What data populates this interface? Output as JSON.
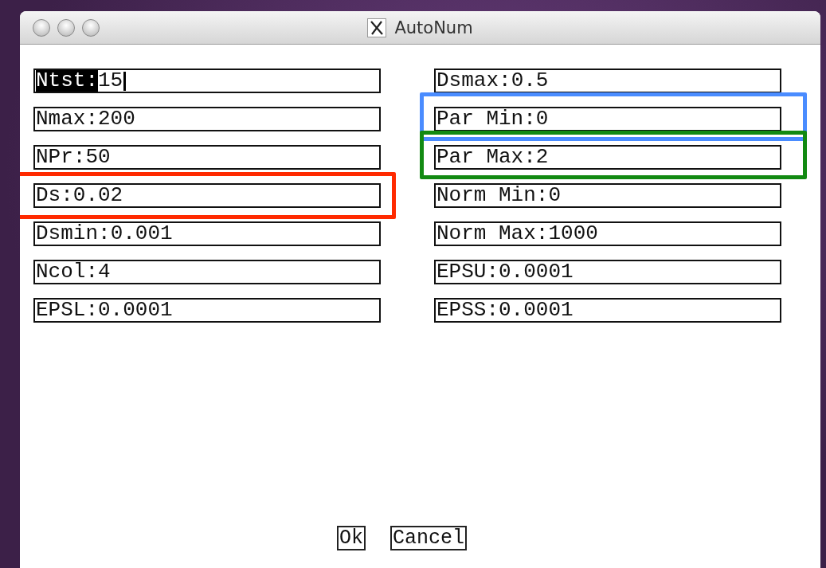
{
  "window": {
    "title": "AutoNum"
  },
  "left_fields": [
    {
      "label": "Ntst:",
      "value": "15",
      "focused": true
    },
    {
      "label": "Nmax:",
      "value": "200",
      "focused": false
    },
    {
      "label": "NPr:",
      "value": "50",
      "focused": false
    },
    {
      "label": "Ds:",
      "value": "0.02",
      "focused": false,
      "color": "#ff2a00"
    },
    {
      "label": "Dsmin:",
      "value": "0.001",
      "focused": false
    },
    {
      "label": "Ncol:",
      "value": "4",
      "focused": false
    },
    {
      "label": "EPSL:",
      "value": "0.0001",
      "focused": false
    }
  ],
  "right_fields": [
    {
      "label": "Dsmax:",
      "value": "0.5",
      "focused": false
    },
    {
      "label": "Par Min:",
      "value": "0",
      "focused": false,
      "color": "#4a8cff"
    },
    {
      "label": "Par Max:",
      "value": "2",
      "focused": false,
      "color": "#128a12"
    },
    {
      "label": "Norm Min:",
      "value": "0",
      "focused": false
    },
    {
      "label": "Norm Max:",
      "value": "1000",
      "focused": false
    },
    {
      "label": "EPSU:",
      "value": "0.0001",
      "focused": false
    },
    {
      "label": "EPSS:",
      "value": "0.0001",
      "focused": false
    }
  ],
  "buttons": [
    "Ok",
    "Cancel"
  ]
}
